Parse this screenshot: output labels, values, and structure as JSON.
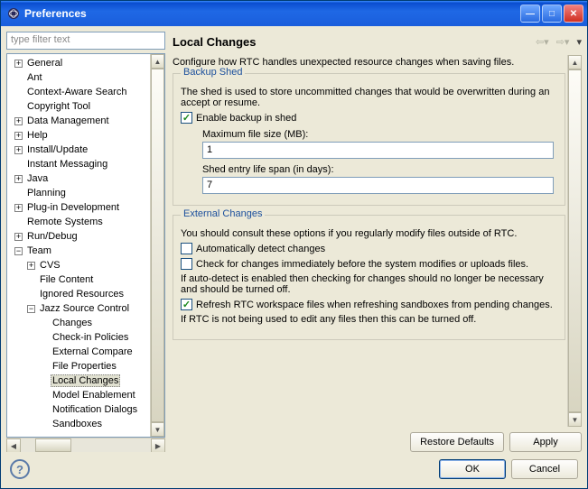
{
  "window": {
    "title": "Preferences"
  },
  "filter": {
    "placeholder": "type filter text"
  },
  "tree": {
    "items": [
      {
        "twisty": "+",
        "indent": 0,
        "label": "General"
      },
      {
        "twisty": "",
        "indent": 0,
        "label": "Ant"
      },
      {
        "twisty": "",
        "indent": 0,
        "label": "Context-Aware Search"
      },
      {
        "twisty": "",
        "indent": 0,
        "label": "Copyright Tool"
      },
      {
        "twisty": "+",
        "indent": 0,
        "label": "Data Management"
      },
      {
        "twisty": "+",
        "indent": 0,
        "label": "Help"
      },
      {
        "twisty": "+",
        "indent": 0,
        "label": "Install/Update"
      },
      {
        "twisty": "",
        "indent": 0,
        "label": "Instant Messaging"
      },
      {
        "twisty": "+",
        "indent": 0,
        "label": "Java"
      },
      {
        "twisty": "",
        "indent": 0,
        "label": "Planning"
      },
      {
        "twisty": "+",
        "indent": 0,
        "label": "Plug-in Development"
      },
      {
        "twisty": "",
        "indent": 0,
        "label": "Remote Systems"
      },
      {
        "twisty": "+",
        "indent": 0,
        "label": "Run/Debug"
      },
      {
        "twisty": "-",
        "indent": 0,
        "label": "Team"
      },
      {
        "twisty": "+",
        "indent": 1,
        "label": "CVS"
      },
      {
        "twisty": "",
        "indent": 1,
        "label": "File Content"
      },
      {
        "twisty": "",
        "indent": 1,
        "label": "Ignored Resources"
      },
      {
        "twisty": "-",
        "indent": 1,
        "label": "Jazz Source Control"
      },
      {
        "twisty": "",
        "indent": 2,
        "label": "Changes"
      },
      {
        "twisty": "",
        "indent": 2,
        "label": "Check-in Policies"
      },
      {
        "twisty": "",
        "indent": 2,
        "label": "External Compare"
      },
      {
        "twisty": "",
        "indent": 2,
        "label": "File Properties"
      },
      {
        "twisty": "",
        "indent": 2,
        "label": "Local Changes",
        "selected": true
      },
      {
        "twisty": "",
        "indent": 2,
        "label": "Model Enablement"
      },
      {
        "twisty": "",
        "indent": 2,
        "label": "Notification Dialogs"
      },
      {
        "twisty": "",
        "indent": 2,
        "label": "Sandboxes"
      }
    ]
  },
  "page": {
    "title": "Local Changes",
    "description": "Configure how RTC handles unexpected resource changes when saving files."
  },
  "backup": {
    "group_title": "Backup Shed",
    "desc": "The shed is used to store uncommitted changes that would be overwritten during an accept or resume.",
    "enable_label": "Enable backup in shed",
    "enable_checked": true,
    "max_size_label": "Maximum file size (MB):",
    "max_size_value": "1",
    "lifespan_label": "Shed entry life span (in days):",
    "lifespan_value": "7"
  },
  "external": {
    "group_title": "External Changes",
    "desc": "You should consult these options if you regularly modify files outside of RTC.",
    "auto_label": "Automatically detect changes",
    "auto_checked": false,
    "check_label": "Check for changes immediately before the system modifies or uploads files.",
    "check_checked": false,
    "note1": "If auto-detect is enabled then checking for changes should no longer be necessary and should be turned off.",
    "refresh_label": "Refresh RTC workspace files when refreshing sandboxes from pending changes.",
    "refresh_checked": true,
    "note2": "If RTC is not being used to edit any files then this can be turned off."
  },
  "buttons": {
    "restore": "Restore Defaults",
    "apply": "Apply",
    "ok": "OK",
    "cancel": "Cancel"
  }
}
